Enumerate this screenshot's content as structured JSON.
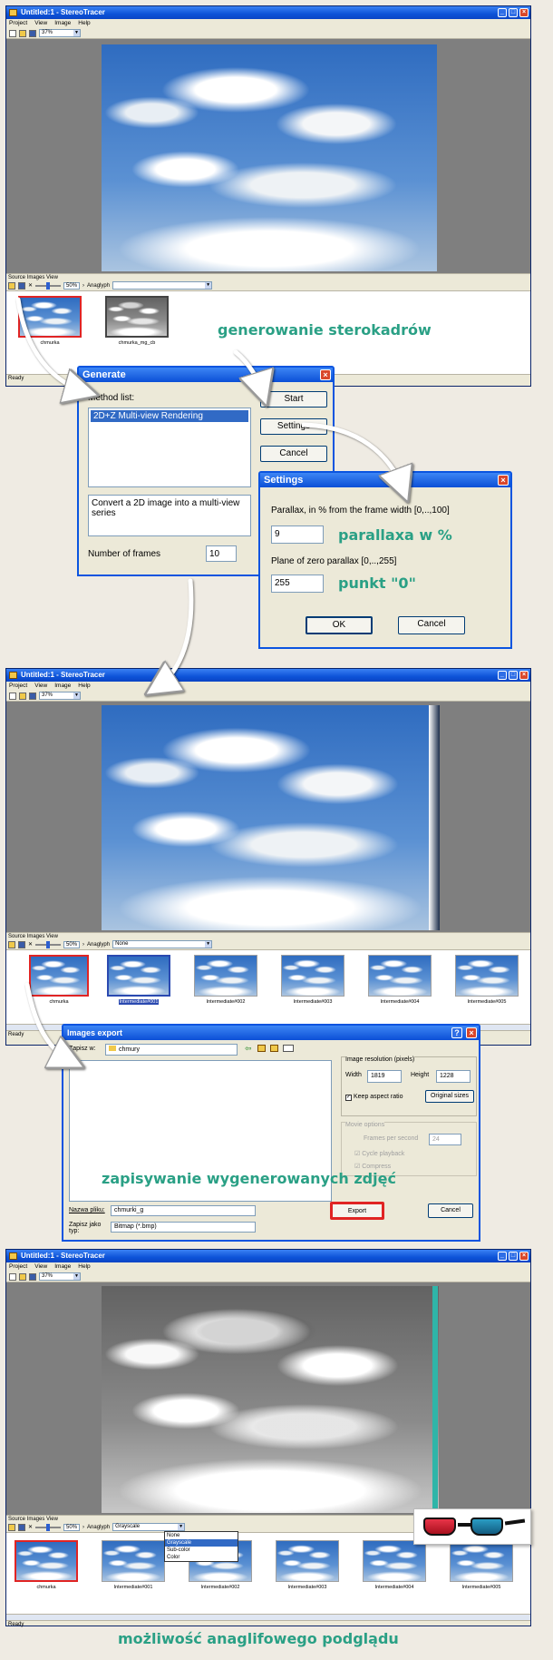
{
  "app": {
    "title": "Untitled:1 - StereoTracer",
    "menu": [
      "Project",
      "View",
      "Image",
      "Help"
    ],
    "zoom": "37%"
  },
  "panel": {
    "label": "Source Images View",
    "zoom_pct": "50%",
    "anaglyph_label": "Anaglyph",
    "anaglyph_none": "None",
    "anaglyph_gray": "Grayscale",
    "anaglyph_options": [
      "None",
      "Grayscale",
      "Sub-color",
      "Color"
    ],
    "status": "Ready"
  },
  "thumbs1": [
    "chmurka",
    "chmurka_mg_cb"
  ],
  "thumbs2": [
    "chmurka",
    "Intermediate#001",
    "Intermediate#002",
    "Intermediate#003",
    "Intermediate#004",
    "Intermediate#005"
  ],
  "generate": {
    "title": "Generate",
    "method_list_label": "Method list:",
    "method_item": "2D+Z Multi-view Rendering",
    "description": "Convert a 2D image into a multi-view series",
    "frames_label": "Number of frames",
    "frames_value": "10",
    "start": "Start",
    "settings": "Settings",
    "cancel": "Cancel"
  },
  "settings": {
    "title": "Settings",
    "parallax_label": "Parallax, in % from the frame width [0,..,100]",
    "parallax_value": "9",
    "zero_label": "Plane of zero parallax [0,..,255]",
    "zero_value": "255",
    "ok": "OK",
    "cancel": "Cancel"
  },
  "export": {
    "title": "Images export",
    "save_in_label": "Zapisz w:",
    "save_in_value": "chmury",
    "resolution_label": "Image resolution (pixels)",
    "width_label": "Width",
    "width_value": "1819",
    "height_label": "Height",
    "height_value": "1228",
    "keep_aspect": "Keep aspect ratio",
    "original_sizes": "Original sizes",
    "movie_options": "Movie options",
    "fps_label": "Frames per second",
    "fps_value": "24",
    "cycle": "Cycle playback",
    "compress": "Compress",
    "filename_label": "Nazwa pliku:",
    "filename_value": "chmurki_g",
    "type_label": "Zapisz jako typ:",
    "type_value": "Bitmap (*.bmp)",
    "export_btn": "Export",
    "cancel_btn": "Cancel"
  },
  "captions": {
    "generowanie": "generowanie sterokadrów",
    "parallaxa": "parallaxa w %",
    "punkt": "punkt \"0\"",
    "zapisywanie": "zapisywanie wygenerowanych zdjęć",
    "mozliwosc": "możliwość anaglifowego podglądu"
  },
  "colors": {
    "caption": "#2aa085",
    "xp_blue": "#0a54e0",
    "highlight_red": "#e02424"
  }
}
